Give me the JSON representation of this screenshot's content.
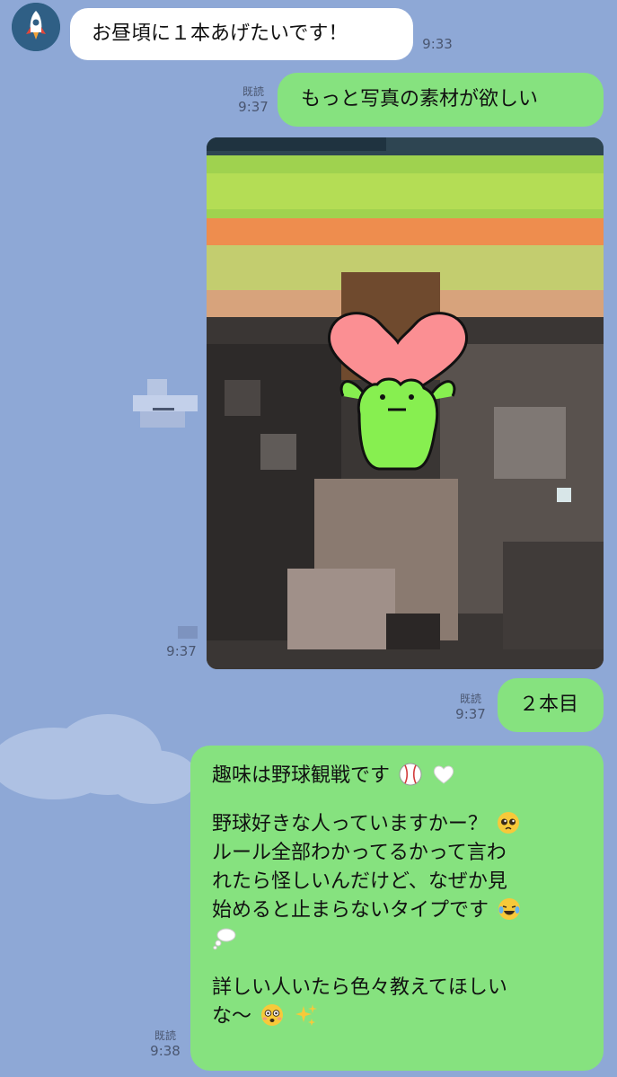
{
  "colors": {
    "background": "#8ea8d6",
    "incoming_bubble": "#ffffff",
    "outgoing_bubble": "#86e27f",
    "meta_text": "#4a5670"
  },
  "messages": {
    "m1": {
      "text": "お昼頃に１本あげたいです！",
      "time": "9:33",
      "avatar_icon": "rocket-icon"
    },
    "m2": {
      "text": "もっと写真の素材が欲しい",
      "read": "既読",
      "time": "9:37"
    },
    "m3": {
      "time": "9:37"
    },
    "m4": {
      "text": "２本目",
      "read": "既読",
      "time": "9:37"
    },
    "m5": {
      "read": "既読",
      "time": "9:38",
      "lines": [
        "趣味は野球観戦です",
        "野球好きな人っていますかー？",
        "ルール全部わかってるかって言わ",
        "れたら怪しいんだけど、なぜか見",
        "始めると止まらないタイプです",
        "詳しい人いたら色々教えてほしい",
        "な〜"
      ],
      "emojis": {
        "line0": [
          "baseball-icon",
          "white-heart-icon"
        ],
        "line1": [
          "pleading-face-icon"
        ],
        "line4": [
          "joy-face-icon",
          "thought-balloon-icon"
        ],
        "line6": [
          "flushed-face-icon",
          "sparkles-icon"
        ]
      }
    }
  }
}
